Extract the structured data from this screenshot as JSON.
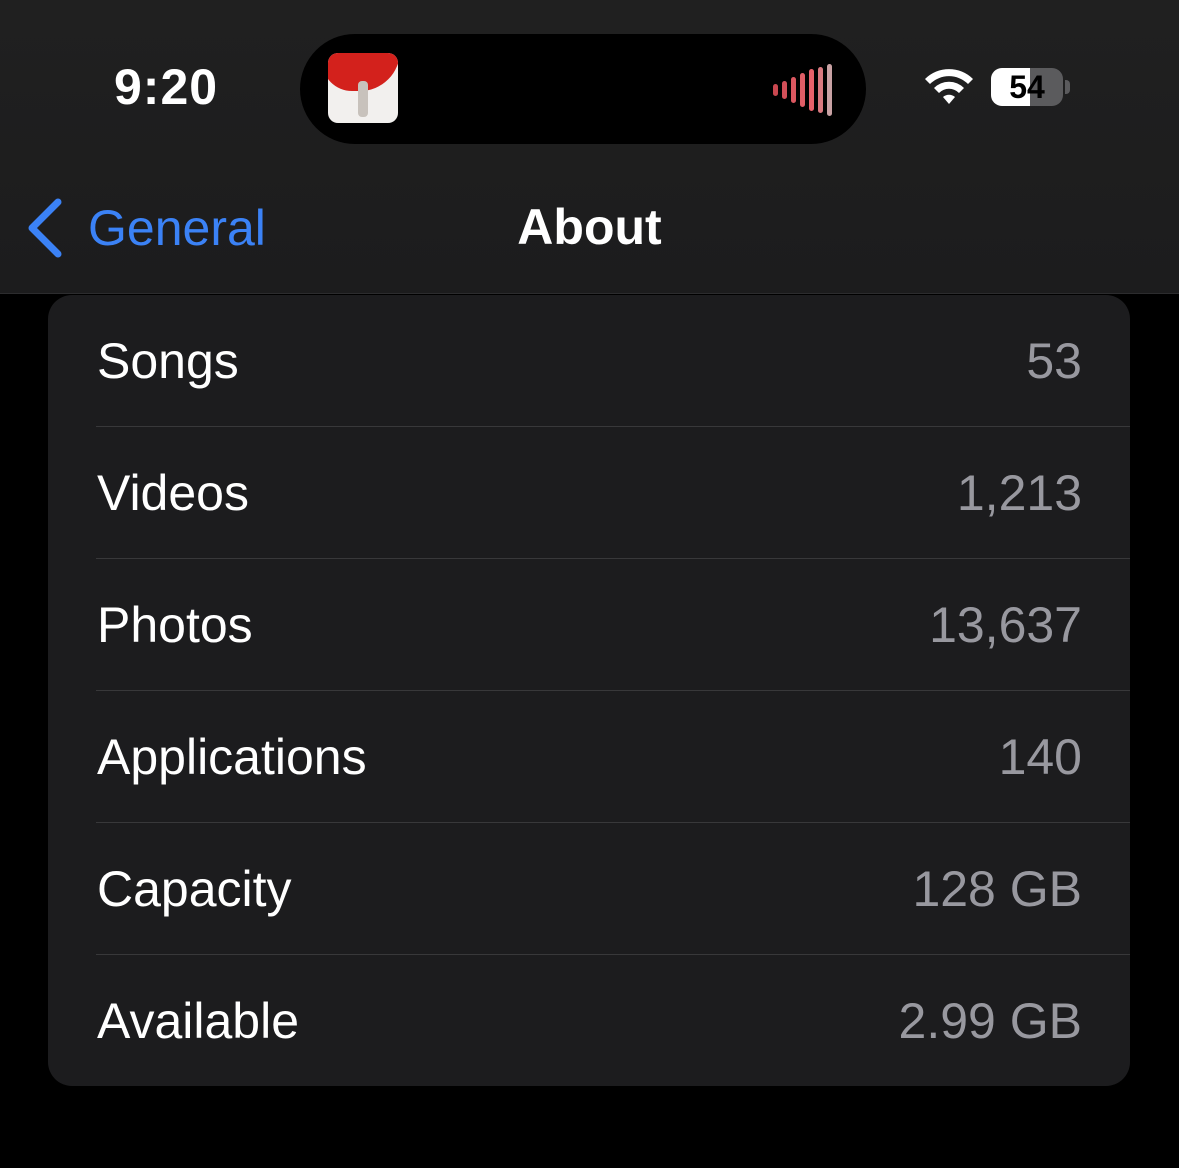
{
  "status_bar": {
    "time": "9:20",
    "battery_percent": "54",
    "battery_level": 0.54,
    "wifi_icon": "wifi-icon",
    "now_playing": {
      "album_icon": "album-art-icon",
      "waveform_icon": "audio-waveform-icon",
      "waveform_color": "#e8616a"
    }
  },
  "nav": {
    "back_label": "General",
    "title": "About"
  },
  "about": {
    "rows": [
      {
        "label": "Songs",
        "value": "53"
      },
      {
        "label": "Videos",
        "value": "1,213"
      },
      {
        "label": "Photos",
        "value": "13,637"
      },
      {
        "label": "Applications",
        "value": "140"
      },
      {
        "label": "Capacity",
        "value": "128 GB"
      },
      {
        "label": "Available",
        "value": "2.99 GB"
      }
    ]
  },
  "colors": {
    "accent": "#3b82f6",
    "background": "#000000",
    "card": "#1c1c1e",
    "secondary_text": "#98989f"
  }
}
